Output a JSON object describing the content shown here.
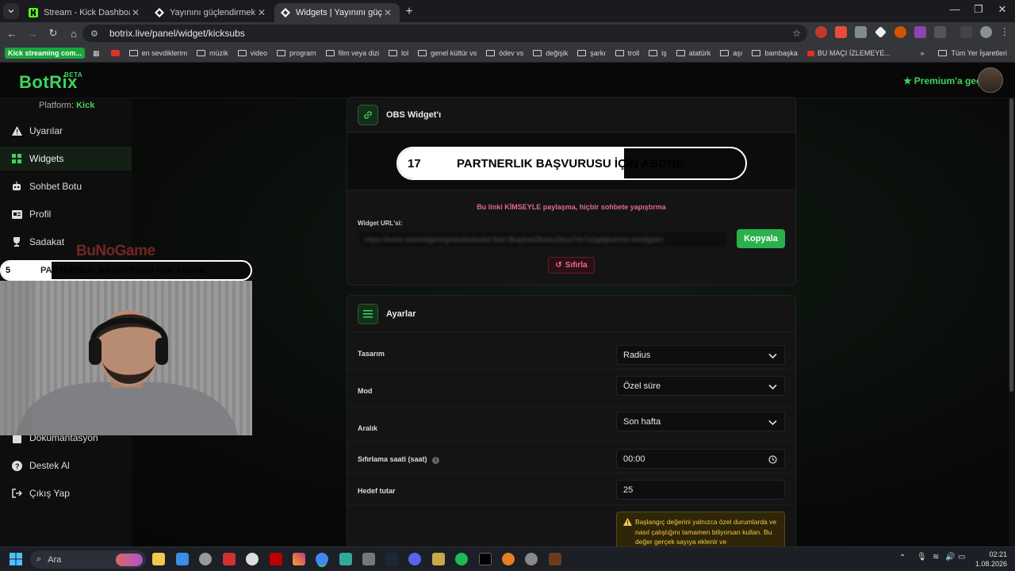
{
  "browser": {
    "tabs": [
      {
        "title": "Stream - Kick Dashboard",
        "active": false
      },
      {
        "title": "Yayınını güçlendirmek için en iy",
        "active": false
      },
      {
        "title": "Widgets | Yayınını güçlendirmek",
        "active": true
      }
    ],
    "new_tab": "+",
    "url": "botrix.live/panel/widget/kicksubs",
    "bookmarks": [
      "Kick streaming com...",
      "en sevdiklerim",
      "müzik",
      "video",
      "program",
      "film veya dizi",
      "lol",
      "genel kültür vs",
      "ödev vs",
      "değişik",
      "şarkı",
      "troll",
      "iş",
      "atatürk",
      "aşı",
      "bambaşka",
      "BU MAÇI İZLEMEYE...",
      "Tüm Yer İşaretleri"
    ]
  },
  "app": {
    "logo": "BotRix",
    "logo_badge": "BETA",
    "premium": "Premium'a geç",
    "platform_label": "Platform:",
    "platform_value": "Kick",
    "sidebar": [
      {
        "label": "Uyarılar",
        "icon": "warning-icon"
      },
      {
        "label": "Widgets",
        "icon": "grid-icon",
        "active": true
      },
      {
        "label": "Sohbet Botu",
        "icon": "robot-icon"
      },
      {
        "label": "Profil",
        "icon": "profile-card-icon"
      },
      {
        "label": "Sadakat",
        "icon": "trophy-icon"
      },
      {
        "label": "Dokümantasyon",
        "icon": "doc-icon"
      },
      {
        "label": "Destek Al",
        "icon": "help-icon"
      },
      {
        "label": "Çıkış Yap",
        "icon": "logout-icon"
      }
    ]
  },
  "obs_card": {
    "title": "OBS Widget'ı",
    "preview": {
      "count": "17",
      "text": "PARTNERLIK BAŞVURUSU İÇİN ABONE",
      "progress": 0.65
    },
    "warning": "Bu linki KİMSEYLE paylaşma, hiçbir sohbete yapıştırma",
    "url_label": "Widget URL'si:",
    "url_value": "https://botrix.live/widgets/goals/kicksubs?bid=8kaj3ws2lka0u2lkpx7dx7a1gdgtwhmm-kickfgjsks",
    "copy_button": "Kopyala",
    "reset_button": "Sıfırla"
  },
  "settings_card": {
    "title": "Ayarlar",
    "rows": {
      "tasarim": {
        "label": "Tasarım",
        "value": "Radius"
      },
      "mod": {
        "label": "Mod",
        "value": "Özel süre"
      },
      "aralik": {
        "label": "Aralık",
        "value": "Son hafta"
      },
      "sifirlama": {
        "label": "Sıfırlama saati (saat)",
        "value": "00:00"
      },
      "hedef": {
        "label": "Hedef tutar",
        "value": "25"
      }
    },
    "notice": "Başlangıç değerini yalnızca özel durumlarda ve nasıl çalıştığını tamamen biliyorsan kullan. Bu değer gerçek sayıya eklenir ve"
  },
  "stream_overlay": {
    "count": "5",
    "text": "PARTNERLIK BAŞVURUSU İÇİN ABONE",
    "progress": 0.2,
    "watermark": "BuNoGame"
  },
  "taskbar": {
    "search_placeholder": "Ara",
    "time": "02:21",
    "date": "1.08.2026"
  },
  "colors": {
    "brand_green": "#3ed35c",
    "danger_pink": "#e06a8c",
    "warning_yellow": "#f3c94a"
  }
}
